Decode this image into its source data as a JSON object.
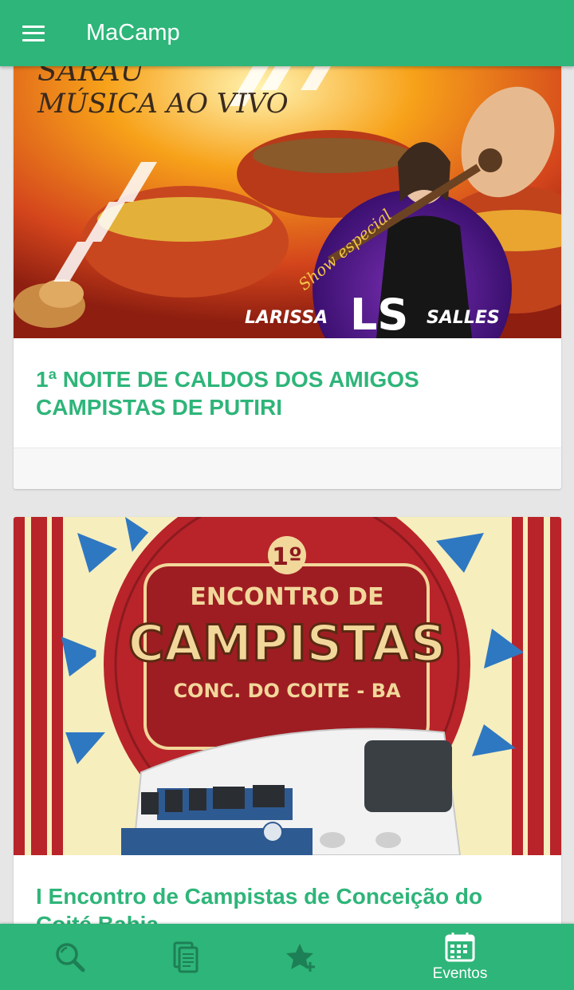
{
  "app": {
    "title": "MaCamp"
  },
  "events": [
    {
      "title": "1ª NOITE DE CALDOS DOS AMIGOS CAMPISTAS DE PUTIRI",
      "banner": {
        "headline": "SARAU MÚSICA AO VIVO",
        "tagline": "Show especial",
        "artist_first": "LARISSA",
        "artist_last": "SALLES",
        "monogram": "LS"
      }
    },
    {
      "title": "I Encontro de Campistas de Conceição do Coité Bahia",
      "banner": {
        "ordinal": "1º",
        "line1": "ENCONTRO DE",
        "line2": "CAMPISTAS",
        "line3": "CONC. DO COITE - BA"
      }
    }
  ],
  "bottom_nav": [
    {
      "icon": "search-icon",
      "label": ""
    },
    {
      "icon": "document-icon",
      "label": ""
    },
    {
      "icon": "star-add-icon",
      "label": ""
    },
    {
      "icon": "calendar-icon",
      "label": "Eventos"
    }
  ],
  "colors": {
    "primary": "#2eb579",
    "background": "#e6e6e6",
    "card": "#ffffff"
  }
}
